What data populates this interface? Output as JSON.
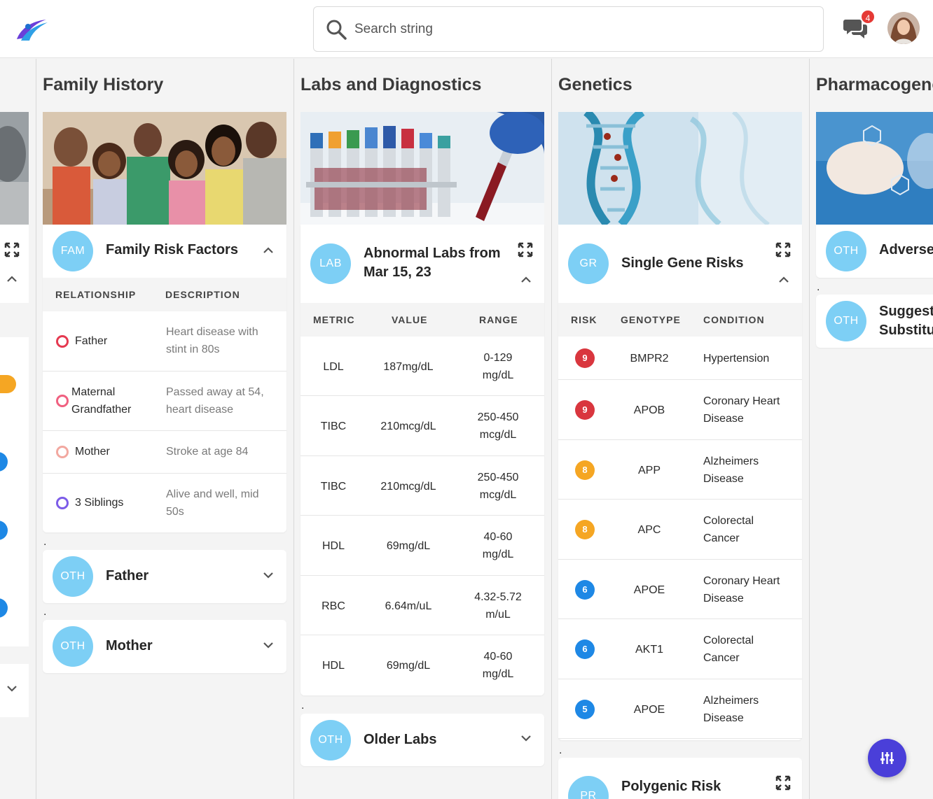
{
  "search": {
    "placeholder": "Search string"
  },
  "header": {
    "notification_count": "4"
  },
  "columns": {
    "family_history": {
      "title": "Family History",
      "risk_card": {
        "badge": "FAM",
        "title": "Family Risk Factors",
        "headers": [
          "RELATIONSHIP",
          "DESCRIPTION"
        ],
        "rows": [
          {
            "relationship": "Father",
            "description": "Heart disease with stint in 80s",
            "ring_color": "#e53950"
          },
          {
            "relationship": "Maternal Grandfather",
            "description": "Passed away at 54, heart disease",
            "ring_color": "#f06080"
          },
          {
            "relationship": "Mother",
            "description": "Stroke at age 84",
            "ring_color": "#f2a8a0"
          },
          {
            "relationship": "3 Siblings",
            "description": "Alive and well, mid 50s",
            "ring_color": "#7c5ce8"
          }
        ]
      },
      "father_card": {
        "badge": "OTH",
        "title": "Father"
      },
      "mother_card": {
        "badge": "OTH",
        "title": "Mother"
      }
    },
    "labs": {
      "title": "Labs and Diagnostics",
      "labs_card": {
        "badge": "LAB",
        "title_line1": "Abnormal Labs from",
        "title_line2": "Mar 15, 23",
        "headers": [
          "METRIC",
          "VALUE",
          "RANGE"
        ],
        "rows": [
          {
            "metric": "LDL",
            "value": "187mg/dL",
            "range1": "0-129",
            "range2": "mg/dL"
          },
          {
            "metric": "TIBC",
            "value": "210mcg/dL",
            "range1": "250-450",
            "range2": "mcg/dL"
          },
          {
            "metric": "TIBC",
            "value": "210mcg/dL",
            "range1": "250-450",
            "range2": "mcg/dL"
          },
          {
            "metric": "HDL",
            "value": "69mg/dL",
            "range1": "40-60",
            "range2": "mg/dL"
          },
          {
            "metric": "RBC",
            "value": "6.64m/uL",
            "range1": "4.32-5.72",
            "range2": "m/uL"
          },
          {
            "metric": "HDL",
            "value": "69mg/dL",
            "range1": "40-60",
            "range2": "mg/dL"
          }
        ]
      },
      "older_card": {
        "badge": "OTH",
        "title": "Older Labs"
      }
    },
    "genetics": {
      "title": "Genetics",
      "gene_card": {
        "badge": "GR",
        "title": "Single Gene Risks",
        "headers": [
          "RISK",
          "GENOTYPE",
          "CONDITION"
        ],
        "rows": [
          {
            "risk": "9",
            "genotype": "BMPR2",
            "condition1": "Hypertension",
            "condition2": "",
            "color": "#d9363e"
          },
          {
            "risk": "9",
            "genotype": "APOB",
            "condition1": "Coronary Heart",
            "condition2": "Disease",
            "color": "#d9363e"
          },
          {
            "risk": "8",
            "genotype": "APP",
            "condition1": "Alzheimers",
            "condition2": "Disease",
            "color": "#f5a623"
          },
          {
            "risk": "8",
            "genotype": "APC",
            "condition1": "Colorectal",
            "condition2": "Cancer",
            "color": "#f5a623"
          },
          {
            "risk": "6",
            "genotype": "APOE",
            "condition1": "Coronary Heart",
            "condition2": "Disease",
            "color": "#1e88e5"
          },
          {
            "risk": "6",
            "genotype": "AKT1",
            "condition1": "Colorectal",
            "condition2": "Cancer",
            "color": "#1e88e5"
          },
          {
            "risk": "5",
            "genotype": "APOE",
            "condition1": "Alzheimers",
            "condition2": "Disease",
            "color": "#1e88e5"
          }
        ]
      },
      "polygenic_card": {
        "badge": "PR",
        "title": "Polygenic Risk"
      }
    },
    "pharma": {
      "title": "Pharmacogenomics",
      "adverse_card": {
        "badge": "OTH",
        "title": "Adverse"
      },
      "suggest_card": {
        "badge": "OTH",
        "title_line1": "Suggested",
        "title_line2": "Substitutions"
      }
    }
  },
  "separator": ".",
  "colors": {
    "badge": "#7dcff5",
    "accent": "#4a3fd9",
    "notification": "#e53935"
  }
}
